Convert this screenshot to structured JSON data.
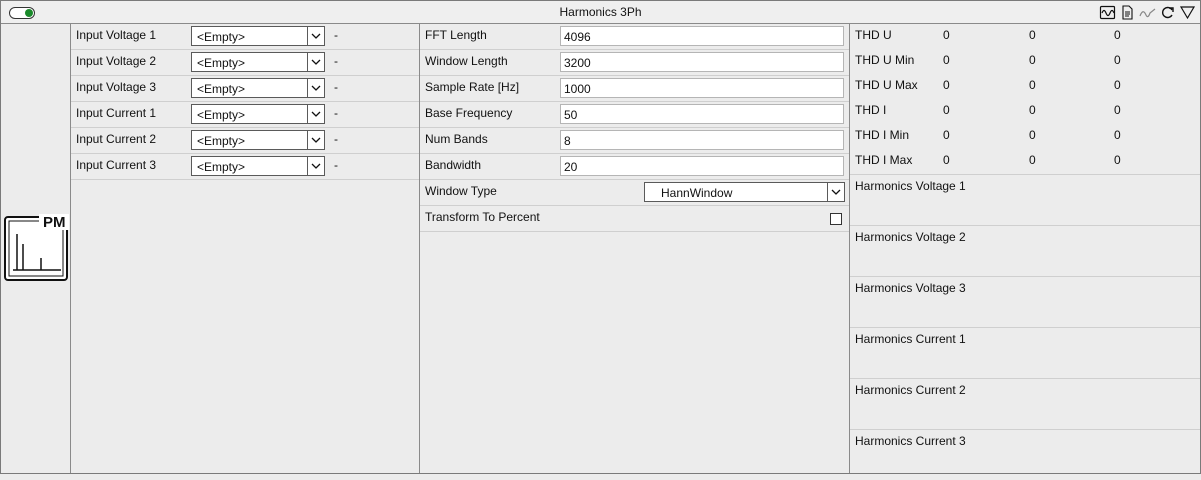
{
  "window": {
    "title": "Harmonics 3Ph"
  },
  "titlebar_icons": [
    "waveform-icon",
    "document-icon",
    "signal-icon",
    "refresh-icon",
    "collapse-icon"
  ],
  "block_icon": {
    "text": "PM"
  },
  "inputs": [
    {
      "label": "Input Voltage 1",
      "value": "<Empty>",
      "status": "-"
    },
    {
      "label": "Input Voltage 2",
      "value": "<Empty>",
      "status": "-"
    },
    {
      "label": "Input Voltage 3",
      "value": "<Empty>",
      "status": "-"
    },
    {
      "label": "Input Current 1",
      "value": "<Empty>",
      "status": "-"
    },
    {
      "label": "Input Current 2",
      "value": "<Empty>",
      "status": "-"
    },
    {
      "label": "Input Current 3",
      "value": "<Empty>",
      "status": "-"
    }
  ],
  "params": [
    {
      "label": "FFT Length",
      "value": "4096"
    },
    {
      "label": "Window Length",
      "value": "3200"
    },
    {
      "label": "Sample Rate [Hz]",
      "value": "1000"
    },
    {
      "label": "Base Frequency",
      "value": "50"
    },
    {
      "label": "Num Bands",
      "value": "8"
    },
    {
      "label": "Bandwidth",
      "value": "20"
    }
  ],
  "window_type": {
    "label": "Window Type",
    "value": "HannWindow"
  },
  "transform": {
    "label": "Transform To Percent",
    "checked": false
  },
  "thd": [
    {
      "label": "THD U",
      "v1": "0",
      "v2": "0",
      "v3": "0"
    },
    {
      "label": "THD U Min",
      "v1": "0",
      "v2": "0",
      "v3": "0"
    },
    {
      "label": "THD U Max",
      "v1": "0",
      "v2": "0",
      "v3": "0"
    },
    {
      "label": "THD I",
      "v1": "0",
      "v2": "0",
      "v3": "0"
    },
    {
      "label": "THD I Min",
      "v1": "0",
      "v2": "0",
      "v3": "0"
    },
    {
      "label": "THD I Max",
      "v1": "0",
      "v2": "0",
      "v3": "0"
    }
  ],
  "harmonics": [
    {
      "label": "Harmonics Voltage 1"
    },
    {
      "label": "Harmonics Voltage 2"
    },
    {
      "label": "Harmonics Voltage 3"
    },
    {
      "label": "Harmonics Current 1"
    },
    {
      "label": "Harmonics Current 2"
    },
    {
      "label": "Harmonics Current 3"
    }
  ]
}
